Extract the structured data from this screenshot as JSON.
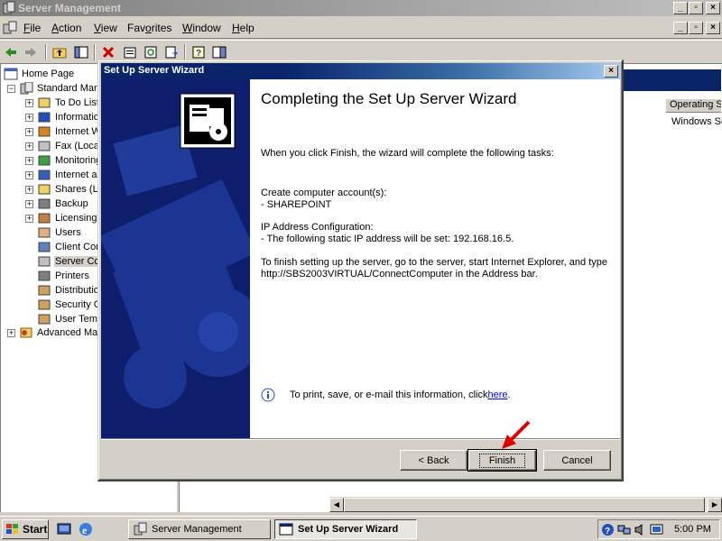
{
  "main_window": {
    "title": "Server Management",
    "menu": [
      {
        "label": "File",
        "u": "F",
        "rest": "ile"
      },
      {
        "label": "Action",
        "u": "A",
        "rest": "ction"
      },
      {
        "label": "View",
        "u": "V",
        "rest": "iew"
      },
      {
        "label": "Favorites",
        "u": "",
        "rest": ""
      },
      {
        "label": "Window",
        "u": "W",
        "rest": "indow"
      },
      {
        "label": "Help",
        "u": "H",
        "rest": "elp"
      }
    ],
    "tree": {
      "home": "Home Page",
      "standard": "Standard Mar",
      "items": [
        "To Do List",
        "Informatio",
        "Internet W",
        "Fax (Loca",
        "Monitoring",
        "Internet a",
        "Shares (L",
        "Backup",
        "Licensing",
        "Users",
        "Client Com",
        "Server Co",
        "Printers",
        "Distributio",
        "Security G",
        "User Tem"
      ],
      "advanced": "Advanced Ma"
    },
    "list": {
      "column_header": "Operating S",
      "value": "Windows Se"
    }
  },
  "wizard": {
    "title": "Set Up Server Wizard",
    "heading": "Completing the Set Up Server Wizard",
    "intro": "When you click Finish, the wizard will complete the following tasks:",
    "task1_line1": "Create computer account(s):",
    "task1_line2": "- SHAREPOINT",
    "task2_line1": "IP Address Configuration:",
    "task2_line2": "- The following static IP address will be set: 192.168.16.5.",
    "task3_line1": "To finish setting up the server, go to the server, start Internet Explorer, and type",
    "task3_line2": "http://SBS2003VIRTUAL/ConnectComputer in the Address bar.",
    "info_text": "To print, save, or e-mail this information, click ",
    "info_link": "here",
    "info_end": ".",
    "back_label": "< Back",
    "finish_label": "Finish",
    "cancel_label": "Cancel"
  },
  "taskbar": {
    "start_label": "Start",
    "tasks": [
      "Server Management",
      "Set Up Server Wizard"
    ],
    "clock": "5:00 PM"
  },
  "colors": {
    "wizard_side": "#0f1e6c",
    "title_active": "#0a246a",
    "arrow": "#e00000"
  }
}
